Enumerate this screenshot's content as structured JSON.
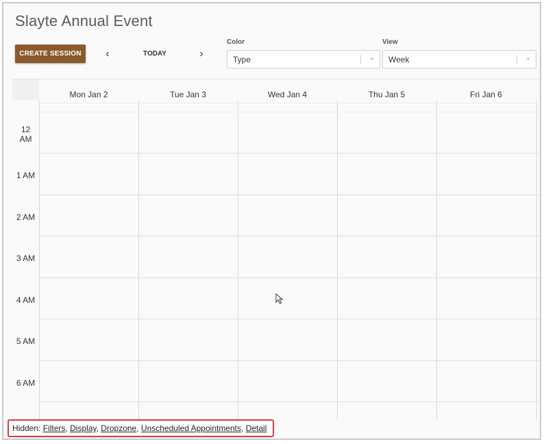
{
  "app": {
    "title": "Slayte Annual Event"
  },
  "toolbar": {
    "create_label": "CREATE SESSION",
    "prev_glyph": "‹",
    "next_glyph": "›",
    "today_label": "TODAY"
  },
  "color_select": {
    "label": "Color",
    "value": "Type"
  },
  "view_select": {
    "label": "View",
    "value": "Week"
  },
  "calendar": {
    "days": [
      "Mon Jan 2",
      "Tue Jan 3",
      "Wed Jan 4",
      "Thu Jan 5",
      "Fri Jan 6"
    ],
    "hours": [
      "12\nAM",
      "1 AM",
      "2 AM",
      "3 AM",
      "4 AM",
      "5 AM",
      "6 AM"
    ]
  },
  "hidden_panels": {
    "prefix": "Hidden:",
    "links": [
      "Filters",
      "Display",
      "Dropzone",
      "Unscheduled Appointments",
      "Detail"
    ]
  },
  "icons": {
    "prev": "chevron-left-icon",
    "next": "chevron-right-icon",
    "dropdown": "chevron-down-icon",
    "cursor": "mouse-pointer-icon"
  },
  "colors": {
    "accent": "#8a5a2b",
    "highlight_border": "#d83b3b"
  }
}
